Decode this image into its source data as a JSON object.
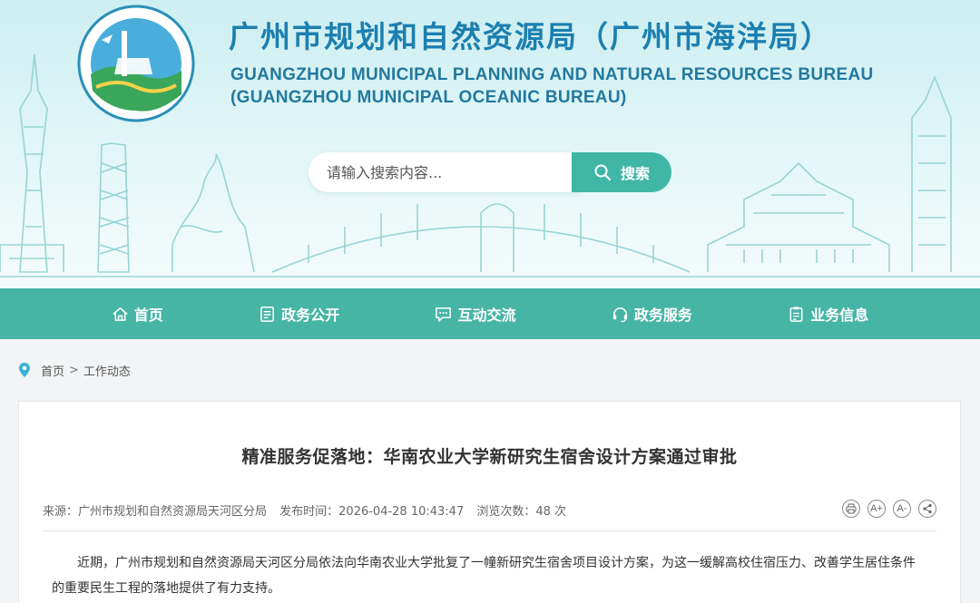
{
  "header": {
    "title_cn": "广州市规划和自然资源局（广州市海洋局）",
    "title_en_line1": "GUANGZHOU MUNICIPAL PLANNING AND NATURAL RESOURCES BUREAU",
    "title_en_line2": "(GUANGZHOU MUNICIPAL OCEANIC BUREAU)",
    "logo_text": "广州市规划和自然资源局 GUANGZHOU MUNICIPAL PLANNING AND NATURAL RESOURCES BUREAU"
  },
  "search": {
    "placeholder": "请输入搜索内容...",
    "button_label": "搜索"
  },
  "nav": {
    "items": [
      {
        "label": "首页",
        "icon": "home-icon"
      },
      {
        "label": "政务公开",
        "icon": "document-icon"
      },
      {
        "label": "互动交流",
        "icon": "chat-icon"
      },
      {
        "label": "政务服务",
        "icon": "headset-icon"
      },
      {
        "label": "业务信息",
        "icon": "clipboard-icon"
      }
    ]
  },
  "breadcrumb": {
    "home": "首页",
    "separator": ">",
    "current": "工作动态"
  },
  "article": {
    "title": "精准服务促落地：华南农业大学新研究生宿舍设计方案通过审批",
    "source": "来源：广州市规划和自然资源局天河区分局",
    "publish_time": "发布时间：2026-04-28 10:43:47",
    "views": "浏览次数：48 次",
    "tools": {
      "print": "print-icon",
      "font_larger": "A+",
      "font_smaller": "A-",
      "share": "share-icon"
    },
    "body": "近期，广州市规划和自然资源局天河区分局依法向华南农业大学批复了一幢新研究生宿舍项目设计方案，为这一缓解高校住宿压力、改善学生居住条件的重要民生工程的落地提供了有力支持。"
  },
  "colors": {
    "accent": "#47b5a6",
    "title_blue": "#1c7fb0",
    "banner_sky": "#d6f1f3"
  }
}
